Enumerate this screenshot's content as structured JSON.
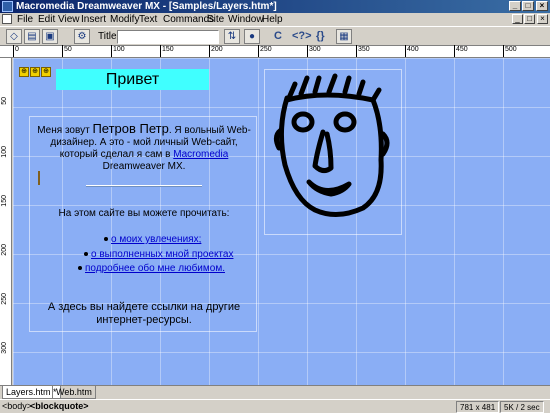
{
  "window": {
    "title": "Macromedia Dreamweaver MX - [Samples/Layers.htm*]",
    "buttons": [
      "_",
      "□",
      "×"
    ]
  },
  "menu": {
    "items": [
      "File",
      "Edit",
      "View",
      "Insert",
      "Modify",
      "Text",
      "Commands",
      "Site",
      "Window",
      "Help"
    ],
    "doc_buttons": [
      "_",
      "□",
      "×"
    ]
  },
  "toolbar": {
    "title_label": "Title:",
    "title_value": "",
    "glyphs": [
      "C",
      "<?>",
      "{}"
    ]
  },
  "ruler": {
    "top_labels": [
      "0",
      "50",
      "100",
      "150",
      "200",
      "250",
      "300",
      "350",
      "400",
      "450",
      "500"
    ],
    "left_labels": [
      "50",
      "100",
      "150",
      "200",
      "250",
      "300"
    ]
  },
  "page": {
    "heading": "Привет",
    "intro_before": "Меня зовут ",
    "name": "Петров Петр",
    "intro_after": ". Я вольный Web-дизайнер. А это - мой личный Web-сайт, который сделал я сам в ",
    "link_macromedia": "Macromedia",
    "intro_end": " Dreamweaver MX.",
    "read_title": "На этом сайте вы можете прочитать:",
    "links": [
      "о моих увлечениях;",
      "о выполненных мной проектах",
      "подробнее обо мне любимом."
    ],
    "outro": "А здесь вы найдете ссылки на другие интернет-ресурсы."
  },
  "tabs": [
    "Layers.htm *",
    "Web.htm"
  ],
  "status": {
    "tag_body": "<body>",
    "tag_blockquote": "<blockquote>",
    "size": "781 x 481",
    "download": "5K / 2 sec"
  },
  "colors": {
    "canvas": "#8aaef5",
    "heading_bg": "#40ffff",
    "link": "#0000cc"
  }
}
